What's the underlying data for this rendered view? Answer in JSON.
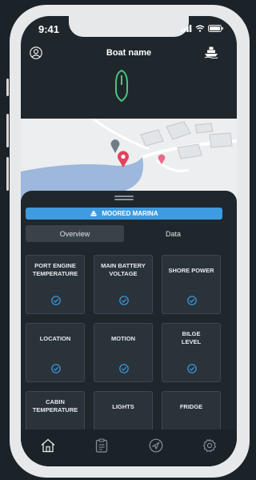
{
  "status_bar": {
    "time": "9:41"
  },
  "header": {
    "title": "Boat name",
    "left_icon": "profile-icon",
    "right_icon": "boat-icon"
  },
  "status_banner": {
    "label": "MOORED MARINA",
    "icon": "boat-icon",
    "color": "#3d9be0"
  },
  "tabs": [
    {
      "label": "Overview",
      "active": true
    },
    {
      "label": "Data",
      "active": false
    }
  ],
  "cards": [
    {
      "label": "PORT ENGINE\nTEMPERATURE",
      "status": "ok"
    },
    {
      "label": "MAIN BATTERY\nVOLTAGE",
      "status": "ok"
    },
    {
      "label": "SHORE POWER",
      "status": "ok"
    },
    {
      "label": "LOCATION",
      "status": "ok"
    },
    {
      "label": "MOTION",
      "status": "ok"
    },
    {
      "label": "BILGE\nLEVEL",
      "status": "ok"
    },
    {
      "label": "CABIN\nTEMPERATURE",
      "status": ""
    },
    {
      "label": "LIGHTS",
      "status": ""
    },
    {
      "label": "FRIDGE",
      "status": ""
    }
  ],
  "tab_bar": [
    {
      "icon": "home-icon",
      "active": true
    },
    {
      "icon": "clipboard-icon",
      "active": false
    },
    {
      "icon": "navigation-icon",
      "active": false
    },
    {
      "icon": "settings-icon",
      "active": false
    }
  ],
  "colors": {
    "background": "#1f272d",
    "card": "#2a323a",
    "accent": "#3d9be0",
    "logo": "#4fc27d",
    "marker": "#e2425e"
  }
}
